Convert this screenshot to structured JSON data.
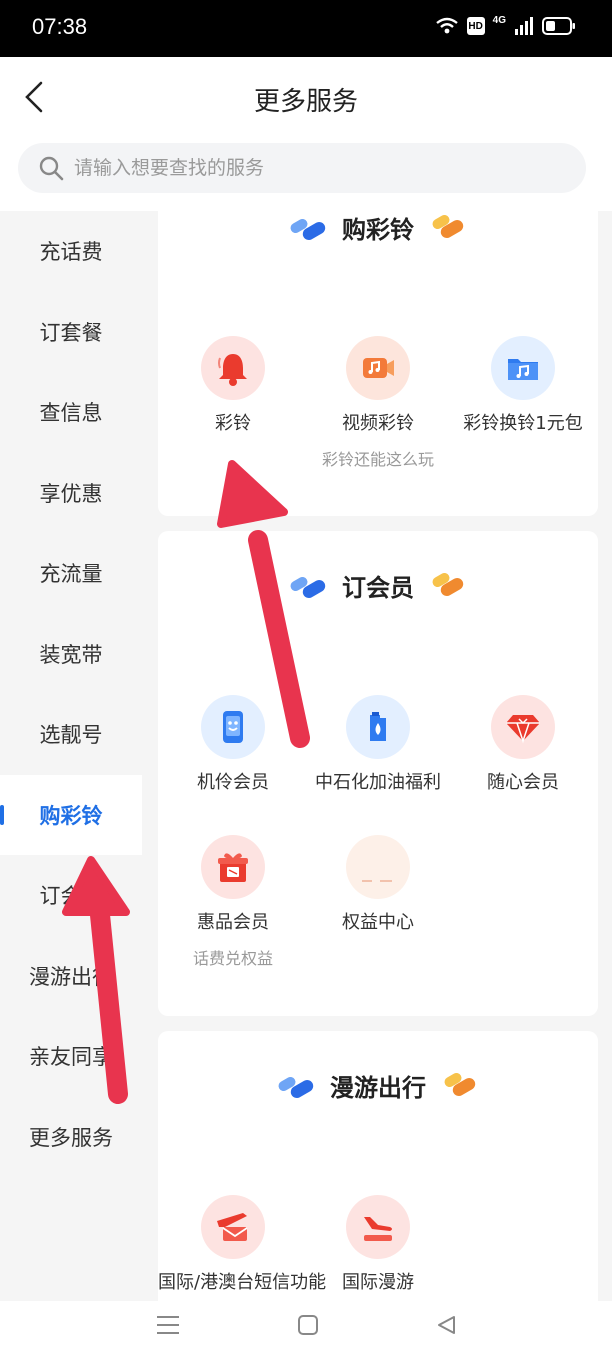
{
  "status_bar": {
    "time": "07:38",
    "hd_label": "HD",
    "network_label": "4G"
  },
  "header": {
    "title": "更多服务"
  },
  "search": {
    "placeholder": "请输入想要查找的服务"
  },
  "sidebar": {
    "items": [
      {
        "label": "充话费"
      },
      {
        "label": "订套餐"
      },
      {
        "label": "查信息"
      },
      {
        "label": "享优惠"
      },
      {
        "label": "充流量"
      },
      {
        "label": "装宽带"
      },
      {
        "label": "选靓号"
      },
      {
        "label": "购彩铃"
      },
      {
        "label": "订会员"
      },
      {
        "label": "漫游出行"
      },
      {
        "label": "亲友同享"
      },
      {
        "label": "更多服务"
      }
    ],
    "active_index": 7
  },
  "sections": [
    {
      "title": "购彩铃",
      "services": [
        {
          "label": "彩铃",
          "icon": "bell-icon"
        },
        {
          "label": "视频彩铃",
          "sub": "彩铃还能这么玩",
          "icon": "video-music-icon"
        },
        {
          "label": "彩铃换铃1元包",
          "icon": "music-folder-icon"
        }
      ]
    },
    {
      "title": "订会员",
      "services": [
        {
          "label": "机伶会员",
          "icon": "phone-mascot-icon"
        },
        {
          "label": "中石化加油福利",
          "icon": "fuel-can-icon"
        },
        {
          "label": "随心会员",
          "icon": "diamond-icon"
        },
        {
          "label": "惠品会员",
          "sub": "话费兑权益",
          "icon": "gift-icon"
        },
        {
          "label": "权益中心",
          "icon": "placeholder-icon"
        }
      ]
    },
    {
      "title": "漫游出行",
      "services": [
        {
          "label": "国际/港澳台短信功能",
          "icon": "plane-mail-icon"
        },
        {
          "label": "国际漫游",
          "icon": "plane-landing-icon"
        }
      ]
    }
  ],
  "colors": {
    "accent": "#1f6fe5",
    "annotation_arrow": "#e8344e",
    "icon_bg_red": "#fde3e1",
    "icon_bg_blue": "#e3efff"
  }
}
